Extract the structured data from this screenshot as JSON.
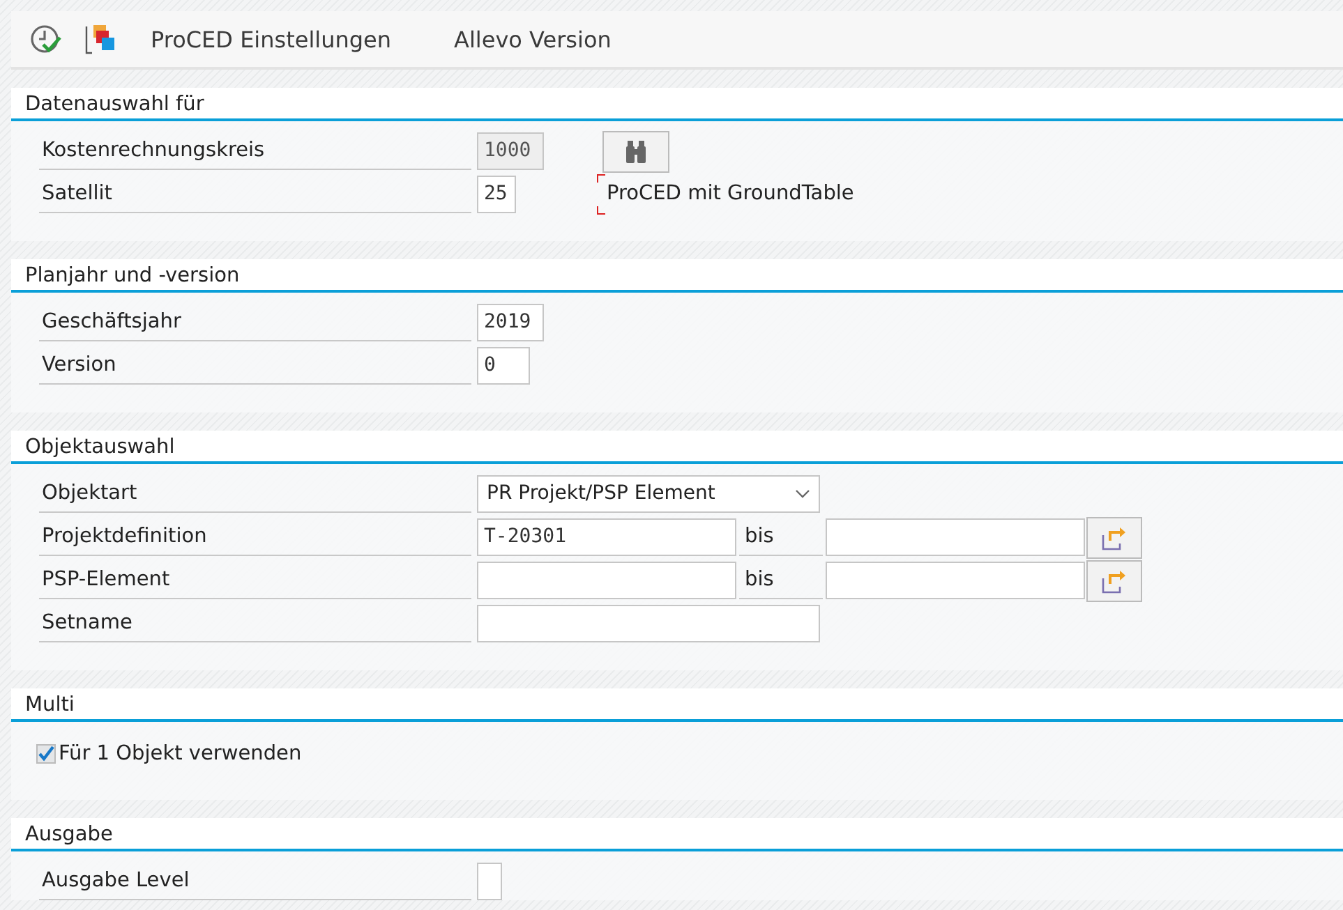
{
  "toolbar": {
    "items": [
      "ProCED Einstellungen",
      "Allevo Version"
    ]
  },
  "sections": [
    {
      "title": "Datenauswahl für",
      "rows": [
        {
          "kind": "field",
          "label": "Kostenrechnungskreis",
          "value": "1000",
          "disabled": true,
          "search_button": true
        },
        {
          "kind": "field",
          "label": "Satellit",
          "value": "25",
          "disabled": false,
          "description": "ProCED mit GroundTable"
        }
      ]
    },
    {
      "title": "Planjahr und -version",
      "rows": [
        {
          "kind": "field",
          "label": "Geschäftsjahr",
          "value": "2019",
          "disabled": false
        },
        {
          "kind": "field",
          "label": "Version",
          "value": "0",
          "disabled": false
        }
      ]
    },
    {
      "title": "Objektauswahl",
      "rows": [
        {
          "kind": "dropdown",
          "label": "Objektart",
          "value": "PR Projekt/PSP Element"
        },
        {
          "kind": "range",
          "label": "Projektdefinition",
          "value": "T-20301",
          "to_label": "bis"
        },
        {
          "kind": "range",
          "label": "PSP-Element",
          "to_label": "bis"
        },
        {
          "kind": "field",
          "label": "Setname",
          "disabled": false
        }
      ]
    },
    {
      "title": "Multi",
      "rows": [
        {
          "kind": "checkbox",
          "label": "Für 1 Objekt verwenden",
          "checked": true
        }
      ]
    },
    {
      "title": "Ausgabe",
      "rows": [
        {
          "kind": "field",
          "label": "Ausgabe Level",
          "disabled": false
        }
      ]
    }
  ]
}
